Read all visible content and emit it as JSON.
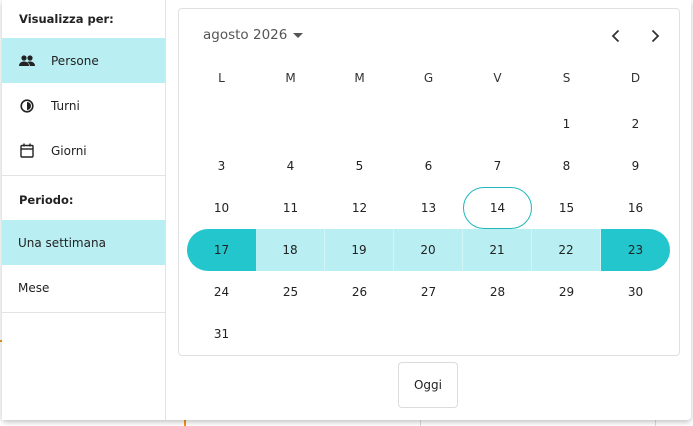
{
  "sidebar": {
    "view_heading": "Visualizza per:",
    "view_options": [
      {
        "label": "Persone",
        "icon": "people-icon",
        "active": true
      },
      {
        "label": "Turni",
        "icon": "shift-icon",
        "active": false
      },
      {
        "label": "Giorni",
        "icon": "calendar-icon",
        "active": false
      }
    ],
    "period_heading": "Periodo:",
    "period_options": [
      {
        "label": "Una settimana",
        "active": true
      },
      {
        "label": "Mese",
        "active": false
      }
    ]
  },
  "calendar": {
    "month_label": "agosto 2026",
    "weekdays": [
      "L",
      "M",
      "M",
      "G",
      "V",
      "S",
      "D"
    ],
    "weeks": [
      [
        "",
        "",
        "",
        "",
        "",
        "1",
        "2"
      ],
      [
        "3",
        "4",
        "5",
        "6",
        "7",
        "8",
        "9"
      ],
      [
        "10",
        "11",
        "12",
        "13",
        "14",
        "15",
        "16"
      ],
      [
        "17",
        "18",
        "19",
        "20",
        "21",
        "22",
        "23"
      ],
      [
        "24",
        "25",
        "26",
        "27",
        "28",
        "29",
        "30"
      ],
      [
        "31",
        "",
        "",
        "",
        "",
        "",
        ""
      ]
    ],
    "today": "14",
    "selected_week_index": 3,
    "today_button": "Oggi"
  },
  "colors": {
    "accent": "#22c6cc",
    "accent_light": "#b9eff2"
  }
}
